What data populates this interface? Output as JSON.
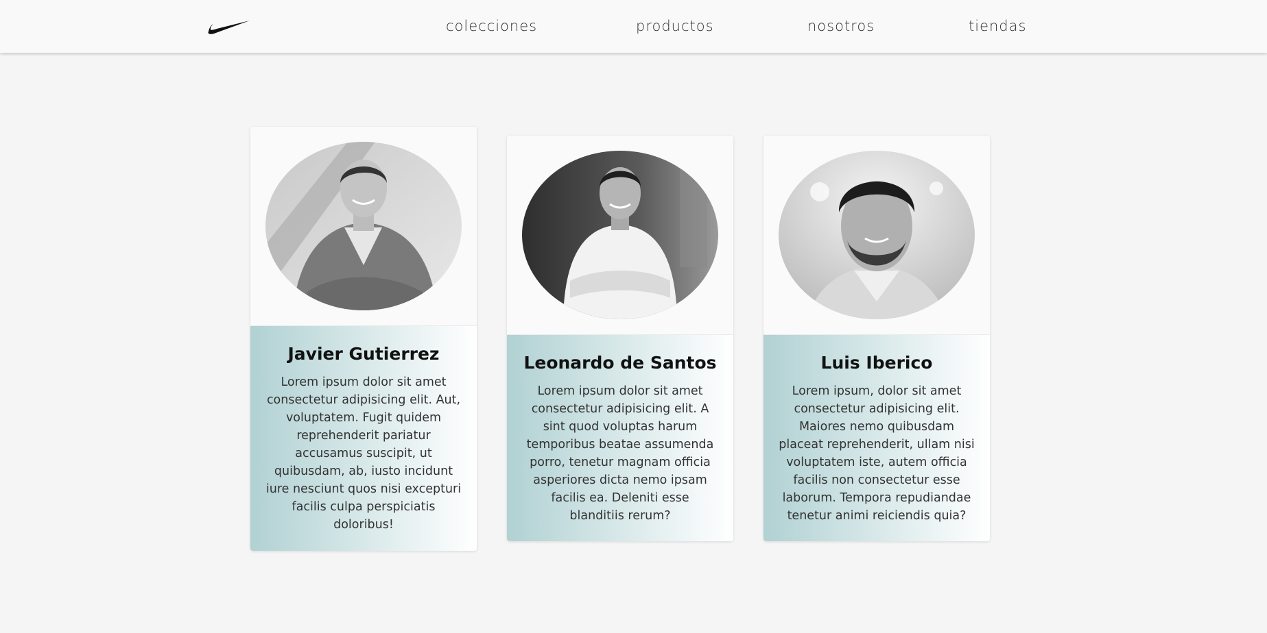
{
  "nav": {
    "logo": "swoosh-logo",
    "links": [
      "colecciones",
      "productos",
      "nosotros",
      "tiendas"
    ]
  },
  "team": [
    {
      "name": "Javier Gutierrez",
      "bio": "Lorem ipsum dolor sit amet consectetur adipisicing elit. Aut, voluptatem. Fugit quidem reprehenderit pariatur accusamus suscipit, ut quibusdam, ab, iusto incidunt iure nesciunt quos nisi excepturi facilis culpa perspiciatis doloribus!"
    },
    {
      "name": "Leonardo de Santos",
      "bio": "Lorem ipsum dolor sit amet consectetur adipisicing elit. A sint quod voluptas harum temporibus beatae assumenda porro, tenetur magnam officia asperiores dicta nemo ipsam facilis ea. Deleniti esse blanditiis rerum?"
    },
    {
      "name": "Luis Iberico",
      "bio": "Lorem ipsum, dolor sit amet consectetur adipisicing elit. Maiores nemo quibusdam placeat reprehenderit, ullam nisi voluptatem iste, autem officia facilis non consectetur esse laborum. Tempora repudiandae tenetur animi reiciendis quia?"
    }
  ],
  "colors": {
    "page_bg": "#f5f5f5",
    "nav_bg": "#f9f9f9",
    "card_gradient_start": "#b1d1d3",
    "card_gradient_end": "#ffffff"
  }
}
